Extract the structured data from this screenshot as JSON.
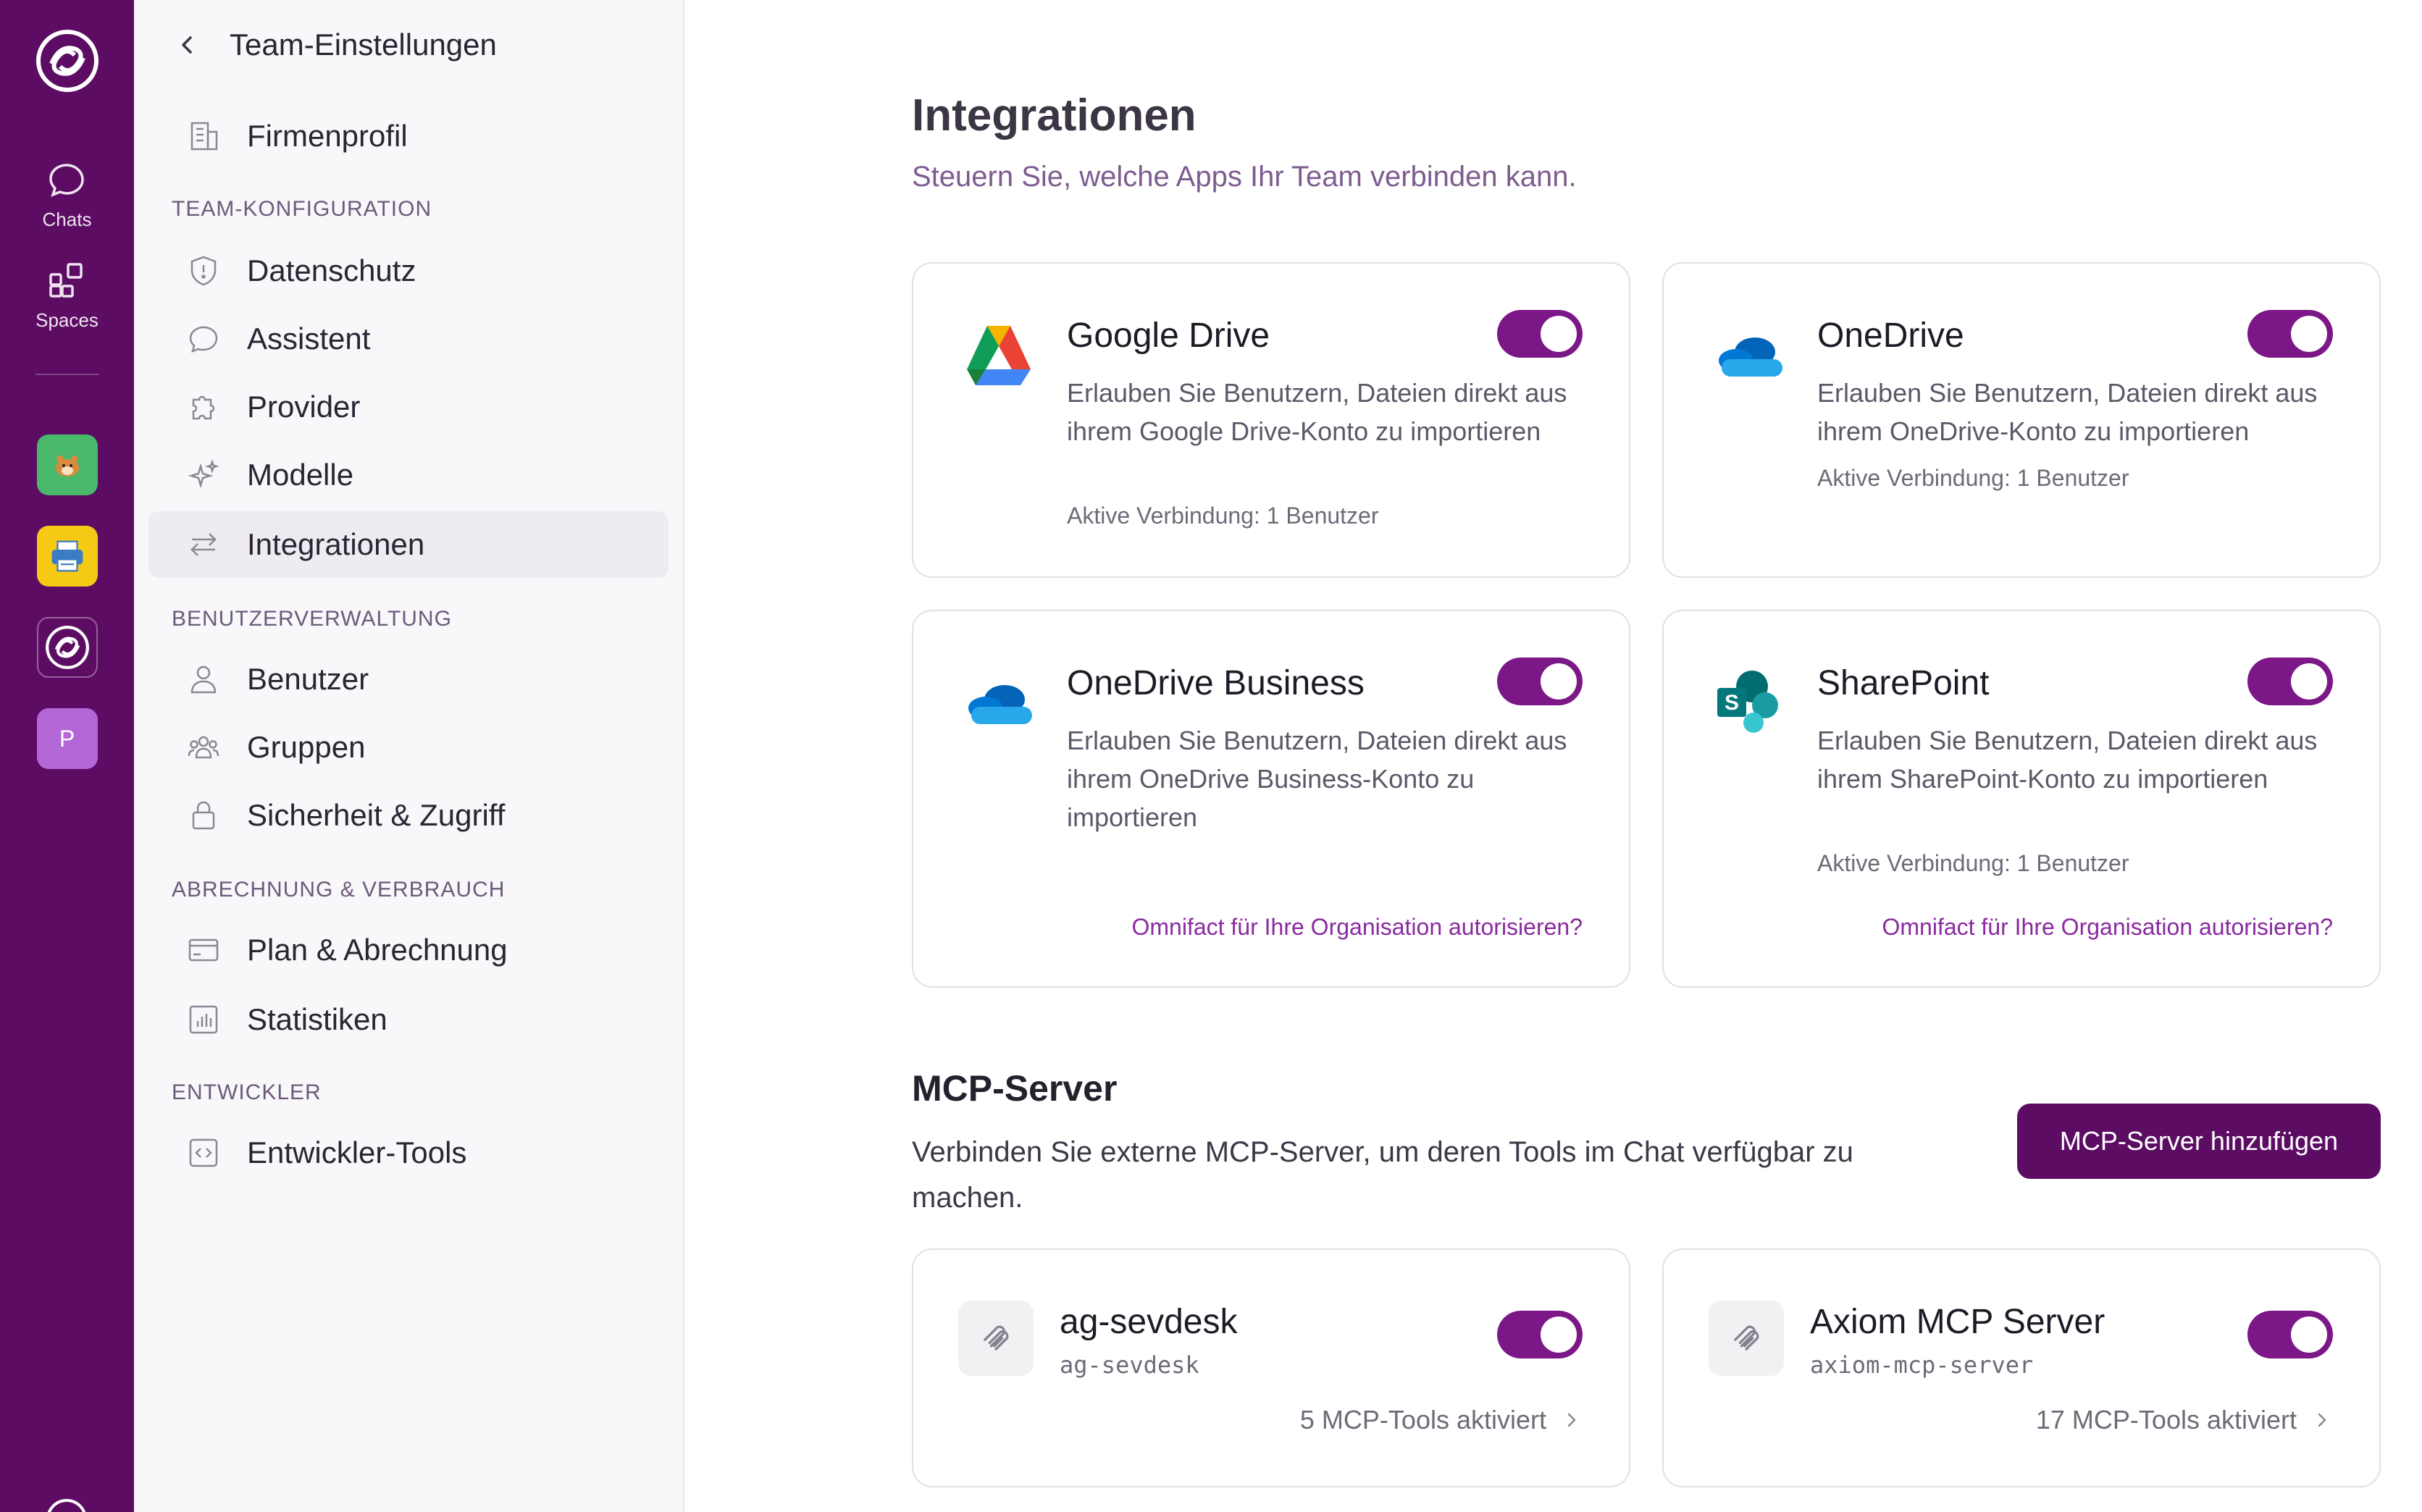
{
  "rail": {
    "chats_label": "Chats",
    "spaces_label": "Spaces",
    "app_p_label": "P"
  },
  "sidebar": {
    "title": "Team-Einstellungen",
    "company_profile": "Firmenprofil",
    "section_team_config": "TEAM-KONFIGURATION",
    "privacy": "Datenschutz",
    "assistant": "Assistent",
    "provider": "Provider",
    "models": "Modelle",
    "integrations": "Integrationen",
    "section_user_mgmt": "BENUTZERVERWALTUNG",
    "users": "Benutzer",
    "groups": "Gruppen",
    "security": "Sicherheit & Zugriff",
    "section_billing": "ABRECHNUNG & VERBRAUCH",
    "plan": "Plan & Abrechnung",
    "stats": "Statistiken",
    "section_dev": "ENTWICKLER",
    "dev_tools": "Entwickler-Tools"
  },
  "main": {
    "title": "Integrationen",
    "subtitle": "Steuern Sie, welche Apps Ihr Team verbinden kann.",
    "integrations": [
      {
        "name": "Google Drive",
        "description": "Erlauben Sie Benutzern, Dateien direkt aus ihrem Google Drive-Konto zu importieren",
        "connection": "Aktive Verbindung: 1 Benutzer",
        "enabled": true
      },
      {
        "name": "OneDrive",
        "description": "Erlauben Sie Benutzern, Dateien direkt aus ihrem OneDrive-Konto zu importieren",
        "connection": "Aktive Verbindung: 1 Benutzer",
        "enabled": true
      },
      {
        "name": "OneDrive Business",
        "description": "Erlauben Sie Benutzern, Dateien direkt aus ihrem OneDrive Business-Konto zu importieren",
        "authorize": "Omnifact für Ihre Organisation autorisieren?",
        "enabled": true
      },
      {
        "name": "SharePoint",
        "description": "Erlauben Sie Benutzern, Dateien direkt aus ihrem SharePoint-Konto zu importieren",
        "connection": "Aktive Verbindung: 1 Benutzer",
        "authorize": "Omnifact für Ihre Organisation autorisieren?",
        "enabled": true
      }
    ],
    "mcp": {
      "title": "MCP-Server",
      "subtitle": "Verbinden Sie externe MCP-Server, um deren Tools im Chat verfügbar zu machen.",
      "add_button": "MCP-Server hinzufügen",
      "servers": [
        {
          "name": "ag-sevdesk",
          "slug": "ag-sevdesk",
          "tools": "5 MCP-Tools aktiviert",
          "enabled": true
        },
        {
          "name": "Axiom MCP Server",
          "slug": "axiom-mcp-server",
          "tools": "17 MCP-Tools aktiviert",
          "enabled": true
        }
      ]
    }
  },
  "colors": {
    "rail": "#5c0d63",
    "accent": "#7b1787",
    "link": "#8a2aa0",
    "subtitle": "#7d5c8f"
  }
}
